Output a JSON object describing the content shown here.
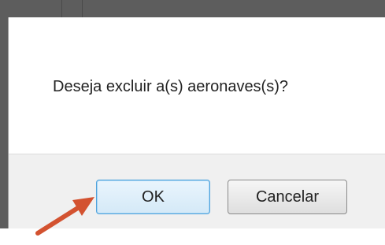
{
  "dialog": {
    "message": "Deseja excluir a(s) aeronaves(s)?",
    "ok_label": "OK",
    "cancel_label": "Cancelar"
  },
  "annotation": {
    "arrow_color": "#d35230"
  },
  "colors": {
    "ok_button_border": "#4fa3dd",
    "footer_background": "#f0f0f0",
    "background_page": "#5d5d5d"
  }
}
